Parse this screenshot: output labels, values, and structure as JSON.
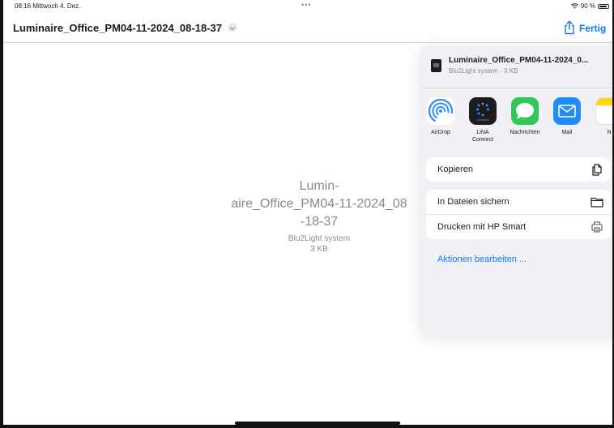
{
  "status_bar": {
    "time_date": "08:16  Mittwoch 4. Dez.",
    "dots": "•••",
    "battery": "90 %",
    "battery_level": 0.9
  },
  "navbar": {
    "title": "Luminaire_Office_PM04-11-2024_08-18-37",
    "done_label": "Fertig",
    "icons": [
      "chevron-down-icon",
      "share-icon"
    ]
  },
  "preview": {
    "name_line1": "Lumin-",
    "name_line2": "aire_Office_PM04-11-2024_08",
    "name_line3": "-18-37",
    "app": "Blu2Light system",
    "size": "3 KB"
  },
  "share_sheet": {
    "file_name": "Luminaire_Office_PM04-11-2024_0...",
    "file_sub": "Blu2Light system · 3 KB",
    "apps": [
      {
        "label": "AirDrop",
        "icon": "airdrop-icon",
        "color": "#2f8ef7"
      },
      {
        "label": "LiNA Connect",
        "line1": "LiNA",
        "line2": "Connect",
        "icon_text": "Connect",
        "icon": "lina-connect-icon",
        "color": "#1c1c1e"
      },
      {
        "label": "Nachrichten",
        "icon": "messages-icon",
        "color": "#33c759"
      },
      {
        "label": "Mail",
        "icon": "mail-icon",
        "color": "#1f8cf7"
      },
      {
        "label": "N",
        "icon": "notes-icon",
        "color": "#ffd60a"
      }
    ],
    "actions": [
      {
        "label": "Kopieren",
        "icon": "copy-icon"
      },
      {
        "label": "In Dateien sichern",
        "icon": "folder-icon"
      },
      {
        "label": "Drucken mit HP Smart",
        "icon": "printer-icon"
      }
    ],
    "edit_actions": "Aktionen bearbeiten ..."
  },
  "colors": {
    "accent": "#0a7aff",
    "sheet_bg": "#f1f1f5"
  }
}
